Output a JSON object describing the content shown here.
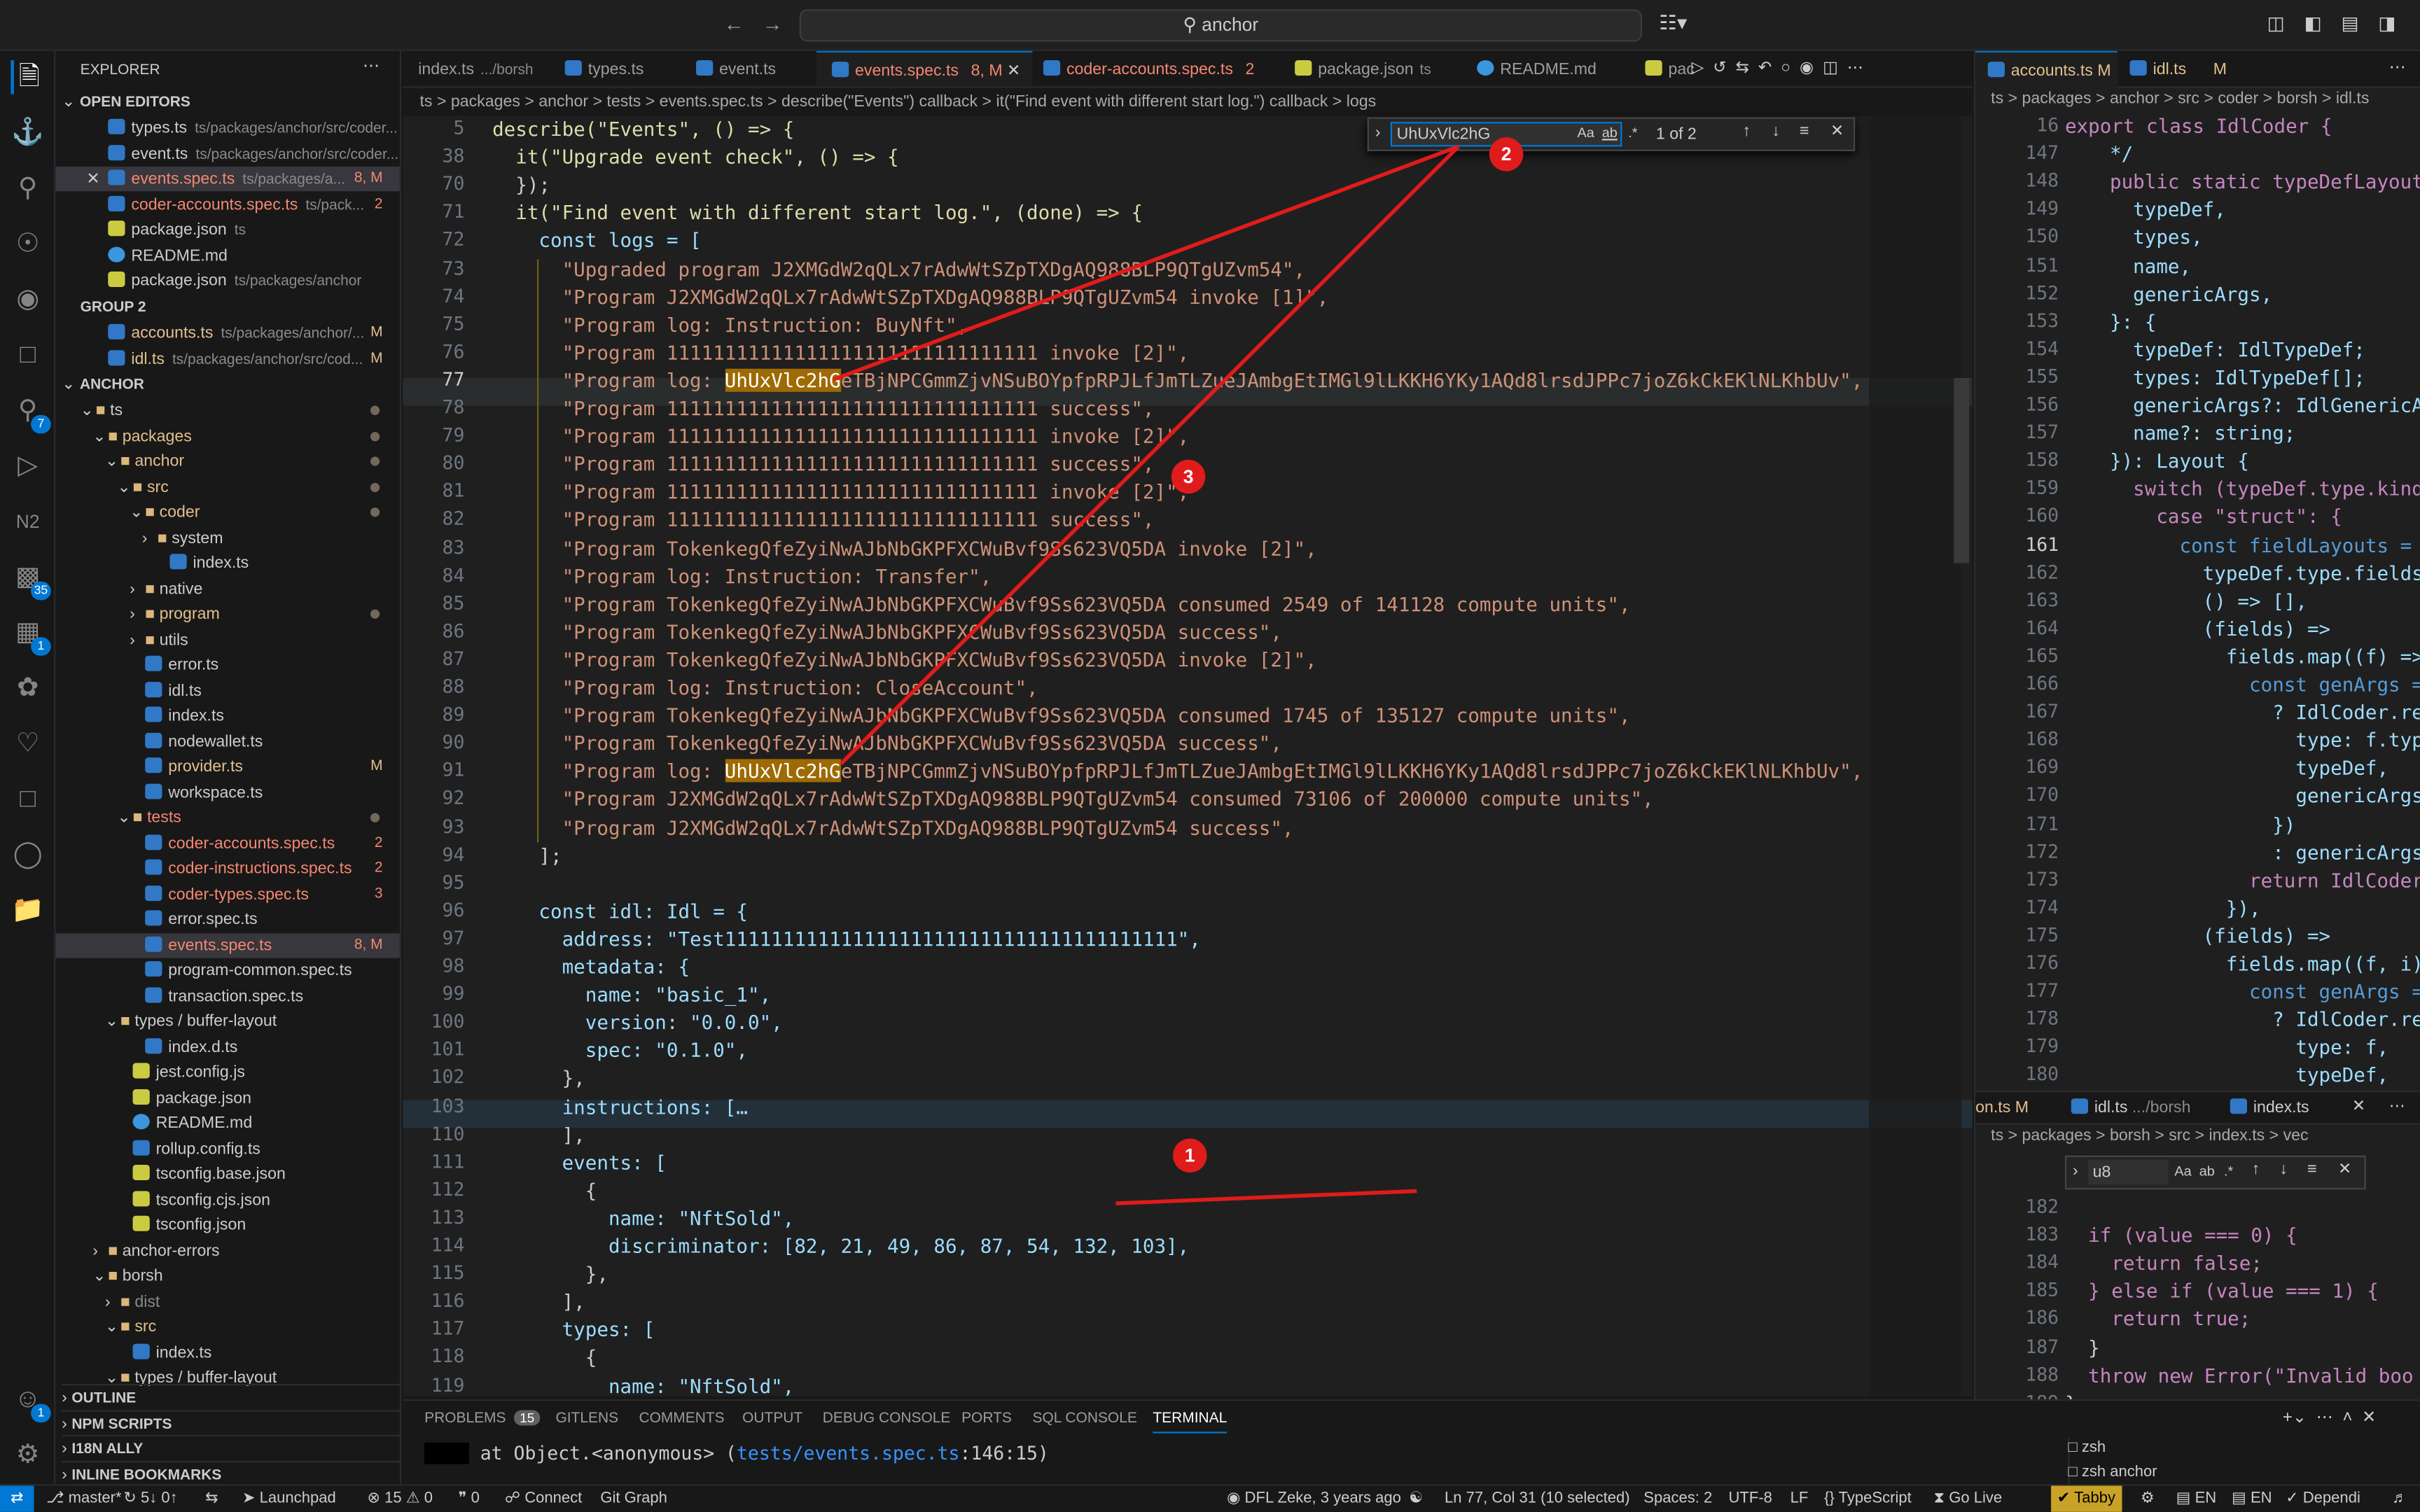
{
  "command_center": {
    "search_text": "anchor"
  },
  "sidebar": {
    "title": "EXPLORER",
    "open_editors_header": "OPEN EDITORS",
    "open_editors": [
      {
        "name": "types.ts",
        "desc": "ts/packages/anchor/src/coder...",
        "status": ""
      },
      {
        "name": "event.ts",
        "desc": "ts/packages/anchor/src/coder...",
        "status": ""
      },
      {
        "name": "events.spec.ts",
        "desc": "ts/packages/a...",
        "status": "8, M"
      },
      {
        "name": "coder-accounts.spec.ts",
        "desc": "ts/pack...",
        "status": "2"
      },
      {
        "name": "package.json",
        "desc": "ts",
        "status": ""
      },
      {
        "name": "README.md",
        "desc": "",
        "status": ""
      },
      {
        "name": "package.json",
        "desc": "ts/packages/anchor",
        "status": ""
      }
    ],
    "group2_header": "GROUP 2",
    "group2": [
      {
        "name": "accounts.ts",
        "desc": "ts/packages/anchor/...",
        "status": "M"
      },
      {
        "name": "idl.ts",
        "desc": "ts/packages/anchor/src/cod...",
        "status": "M"
      }
    ],
    "workspace_header": "ANCHOR",
    "tree": [
      {
        "name": "ts",
        "status": ""
      },
      {
        "name": "packages",
        "status": ""
      },
      {
        "name": "anchor",
        "status": ""
      },
      {
        "name": "src",
        "status": ""
      },
      {
        "name": "coder",
        "status": ""
      },
      {
        "name": "system",
        "status": ""
      },
      {
        "name": "index.ts",
        "status": ""
      },
      {
        "name": "native",
        "status": ""
      },
      {
        "name": "program",
        "status": ""
      },
      {
        "name": "utils",
        "status": ""
      },
      {
        "name": "error.ts",
        "status": ""
      },
      {
        "name": "idl.ts",
        "status": ""
      },
      {
        "name": "index.ts",
        "status": ""
      },
      {
        "name": "nodewallet.ts",
        "status": ""
      },
      {
        "name": "provider.ts",
        "status": "M"
      },
      {
        "name": "workspace.ts",
        "status": ""
      },
      {
        "name": "tests",
        "status": ""
      },
      {
        "name": "coder-accounts.spec.ts",
        "status": "2"
      },
      {
        "name": "coder-instructions.spec.ts",
        "status": "2"
      },
      {
        "name": "coder-types.spec.ts",
        "status": "3"
      },
      {
        "name": "error.spec.ts",
        "status": ""
      },
      {
        "name": "events.spec.ts",
        "status": "8, M"
      },
      {
        "name": "program-common.spec.ts",
        "status": ""
      },
      {
        "name": "transaction.spec.ts",
        "status": ""
      },
      {
        "name": "types / buffer-layout",
        "status": ""
      },
      {
        "name": "index.d.ts",
        "status": ""
      },
      {
        "name": "jest.config.js",
        "status": ""
      },
      {
        "name": "package.json",
        "status": ""
      },
      {
        "name": "README.md",
        "status": ""
      },
      {
        "name": "rollup.config.ts",
        "status": ""
      },
      {
        "name": "tsconfig.base.json",
        "status": ""
      },
      {
        "name": "tsconfig.cjs.json",
        "status": ""
      },
      {
        "name": "tsconfig.json",
        "status": ""
      },
      {
        "name": "anchor-errors",
        "status": ""
      },
      {
        "name": "borsh",
        "status": ""
      },
      {
        "name": "dist",
        "status": ""
      },
      {
        "name": "src",
        "status": ""
      },
      {
        "name": "index.ts",
        "status": ""
      },
      {
        "name": "types / buffer-layout",
        "status": ""
      }
    ],
    "bottom_sections": [
      "OUTLINE",
      "NPM SCRIPTS",
      "I18N ALLY",
      "INLINE BOOKMARKS"
    ]
  },
  "editor": {
    "tabs": [
      {
        "label": "index.ts",
        "desc": ".../borsh",
        "status": ""
      },
      {
        "label": "types.ts",
        "desc": "",
        "status": ""
      },
      {
        "label": "event.ts",
        "desc": "",
        "status": ""
      },
      {
        "label": "events.spec.ts",
        "desc": "",
        "status": "8, M"
      },
      {
        "label": "coder-accounts.spec.ts",
        "desc": "",
        "status": "2"
      },
      {
        "label": "package.json",
        "desc": "ts",
        "status": ""
      },
      {
        "label": "README.md",
        "desc": "",
        "status": ""
      },
      {
        "label": "pac",
        "desc": "",
        "status": ""
      }
    ],
    "breadcrumb": "ts > packages > anchor > tests > events.spec.ts > describe(\"Events\") callback > it(\"Find event with different start log.\") callback > logs",
    "find": {
      "query": "UhUxVlc2hG",
      "result": "1 of 2"
    },
    "line_numbers": [
      "5",
      "38",
      "70",
      "71",
      "72",
      "73",
      "74",
      "75",
      "76",
      "77",
      "78",
      "79",
      "80",
      "81",
      "82",
      "83",
      "84",
      "85",
      "86",
      "87",
      "88",
      "89",
      "90",
      "91",
      "92",
      "93",
      "94",
      "95",
      "96",
      "97",
      "98",
      "99",
      "100",
      "101",
      "102",
      "103",
      "110",
      "111",
      "112",
      "113",
      "114",
      "115",
      "116",
      "117",
      "118",
      "119"
    ],
    "lines": {
      "l5": "describe(\"Events\", () => {",
      "l38": "  it(\"Upgrade event check\", () => {",
      "l70": "  });",
      "l71": "  it(\"Find event with different start log.\", (done) => {",
      "l72": "    const logs = [",
      "l73": "      \"Upgraded program J2XMGdW2qQLx7rAdwWtSZpTXDgAQ988BLP9QTgUZvm54\",",
      "l74": "      \"Program J2XMGdW2qQLx7rAdwWtSZpTXDgAQ988BLP9QTgUZvm54 invoke [1]\",",
      "l75": "      \"Program log: Instruction: BuyNft\",",
      "l76": "      \"Program 11111111111111111111111111111111 invoke [2]\",",
      "l77a": "      \"Program log: ",
      "l77h": "UhUxVlc2hG",
      "l77b": "eTBjNPCGmmZjvNSuBOYpfpRPJLfJmTLZueJAmbgEtIMGl9lLKKH6YKy1AQd8lrsdJPPc7joZ6kCkEKlNLKhbUv\",",
      "l78": "      \"Program 11111111111111111111111111111111 success\",",
      "l79": "      \"Program 11111111111111111111111111111111 invoke [2]\",",
      "l80": "      \"Program 11111111111111111111111111111111 success\",",
      "l81": "      \"Program 11111111111111111111111111111111 invoke [2]\",",
      "l82": "      \"Program 11111111111111111111111111111111 success\",",
      "l83": "      \"Program TokenkegQfeZyiNwAJbNbGKPFXCWuBvf9Ss623VQ5DA invoke [2]\",",
      "l84": "      \"Program log: Instruction: Transfer\",",
      "l85": "      \"Program TokenkegQfeZyiNwAJbNbGKPFXCWuBvf9Ss623VQ5DA consumed 2549 of 141128 compute units\",",
      "l86": "      \"Program TokenkegQfeZyiNwAJbNbGKPFXCWuBvf9Ss623VQ5DA success\",",
      "l87": "      \"Program TokenkegQfeZyiNwAJbNbGKPFXCWuBvf9Ss623VQ5DA invoke [2]\",",
      "l88": "      \"Program log: Instruction: CloseAccount\",",
      "l89": "      \"Program TokenkegQfeZyiNwAJbNbGKPFXCWuBvf9Ss623VQ5DA consumed 1745 of 135127 compute units\",",
      "l90": "      \"Program TokenkegQfeZyiNwAJbNbGKPFXCWuBvf9Ss623VQ5DA success\",",
      "l91a": "      \"Program log: ",
      "l91h": "UhUxVlc2hG",
      "l91b": "eTBjNPCGmmZjvNSuBOYpfpRPJLfJmTLZueJAmbgEtIMGl9lLKKH6YKy1AQd8lrsdJPPc7joZ6kCkEKlNLKhbUv\",",
      "l92": "      \"Program J2XMGdW2qQLx7rAdwWtSZpTXDgAQ988BLP9QTgUZvm54 consumed 73106 of 200000 compute units\",",
      "l93": "      \"Program J2XMGdW2qQLx7rAdwWtSZpTXDgAQ988BLP9QTgUZvm54 success\",",
      "l94": "    ];",
      "l95": "",
      "l96": "    const idl: Idl = {",
      "l97": "      address: \"Test111111111111111111111111111111111111111\",",
      "l98": "      metadata: {",
      "l99": "        name: \"basic_1\",",
      "l100": "        version: \"0.0.0\",",
      "l101": "        spec: \"0.1.0\",",
      "l102": "      },",
      "l103": "      instructions: […",
      "l110": "      ],",
      "l111": "      events: [",
      "l112": "        {",
      "l113": "          name: \"NftSold\",",
      "l114": "          discriminator: [82, 21, 49, 86, 87, 54, 132, 103],",
      "l115": "        },",
      "l116": "      ],",
      "l117": "      types: [",
      "l118": "        {",
      "l119": "          name: \"NftSold\","
    },
    "annotations": [
      "1",
      "2",
      "3"
    ]
  },
  "right_editor": {
    "tabs": [
      {
        "label": "accounts.ts",
        "status": "M"
      },
      {
        "label": "idl.ts",
        "status": "M"
      }
    ],
    "breadcrumb": "ts > packages > anchor > src > coder > borsh > idl.ts",
    "line_numbers": [
      "16",
      "147",
      "148",
      "149",
      "150",
      "151",
      "152",
      "153",
      "154",
      "155",
      "156",
      "157",
      "158",
      "159",
      "160",
      "161",
      "162",
      "163",
      "164",
      "165",
      "166",
      "167",
      "168",
      "169",
      "170",
      "171",
      "172",
      "173",
      "174",
      "175",
      "176",
      "177",
      "178",
      "179",
      "180"
    ],
    "lines": [
      "export class IdlCoder {",
      "  */",
      "  public static typeDefLayout(",
      "    typeDef,",
      "    types,",
      "    name,",
      "    genericArgs,",
      "  }: {",
      "    typeDef: IdlTypeDef;",
      "    types: IdlTypeDef[];",
      "    genericArgs?: IdlGenericAr",
      "    name?: string;",
      "  }): Layout {",
      "    switch (typeDef.type.kind)",
      "      case \"struct\": {",
      "        const fieldLayouts = ha",
      "          typeDef.type.fields,",
      "          () => [],",
      "          (fields) =>",
      "            fields.map((f) =>",
      "              const genArgs = ",
      "                ? IdlCoder.res",
      "                  type: f.type",
      "                  typeDef,",
      "                  genericArgs,",
      "                })",
      "                : genericArgs;",
      "              return IdlCoder.",
      "            }),",
      "          (fields) =>",
      "            fields.map((f, i)",
      "              const genArgs = ",
      "                ? IdlCoder.res",
      "                  type: f,",
      "                  typeDef,"
    ],
    "bottom_tabs": [
      {
        "label": "on.ts",
        "status": "M"
      },
      {
        "label": "idl.ts",
        "desc": ".../borsh",
        "status": ""
      },
      {
        "label": "index.ts",
        "status": ""
      }
    ],
    "bottom_breadcrumb": "ts > packages > borsh > src > index.ts > vec",
    "find": {
      "query": "u8"
    },
    "bottom_line_numbers": [
      "182",
      "183",
      "184",
      "185",
      "186",
      "187",
      "188",
      "189",
      "190"
    ],
    "bottom_lines": [
      "",
      "  if (value === 0) {",
      "    return false;",
      "  } else if (value === 1) {",
      "    return true;",
      "  }",
      "  throw new Error(\"Invalid boo",
      "}",
      ""
    ]
  },
  "panel": {
    "tabs": [
      "PROBLEMS",
      "GITLENS",
      "COMMENTS",
      "OUTPUT",
      "DEBUG CONSOLE",
      "PORTS",
      "SQL CONSOLE",
      "TERMINAL"
    ],
    "problems_count": "15",
    "terminal_text_a": "at Object.<anonymous> (",
    "terminal_text_link": "tests/events.spec.ts",
    "terminal_text_b": ":146:15)",
    "terminals": [
      "zsh",
      "zsh anchor"
    ]
  },
  "status_bar": {
    "branch": "master*",
    "sync": "5↓ 0↑",
    "launchpad": "Launchpad",
    "errors": "15",
    "warnings": "0",
    "ports": "0",
    "connect": "Connect",
    "git_graph": "Git Graph",
    "blame": "DFL Zeke, 3 years ago",
    "position": "Ln 77, Col 31 (10 selected)",
    "spaces": "Spaces: 2",
    "encoding": "UTF-8",
    "eol": "LF",
    "language": "TypeScript",
    "golive": "Go Live",
    "tabby": "Tabby",
    "lang1": "EN",
    "lang2": "EN",
    "deps": "Dependi"
  }
}
